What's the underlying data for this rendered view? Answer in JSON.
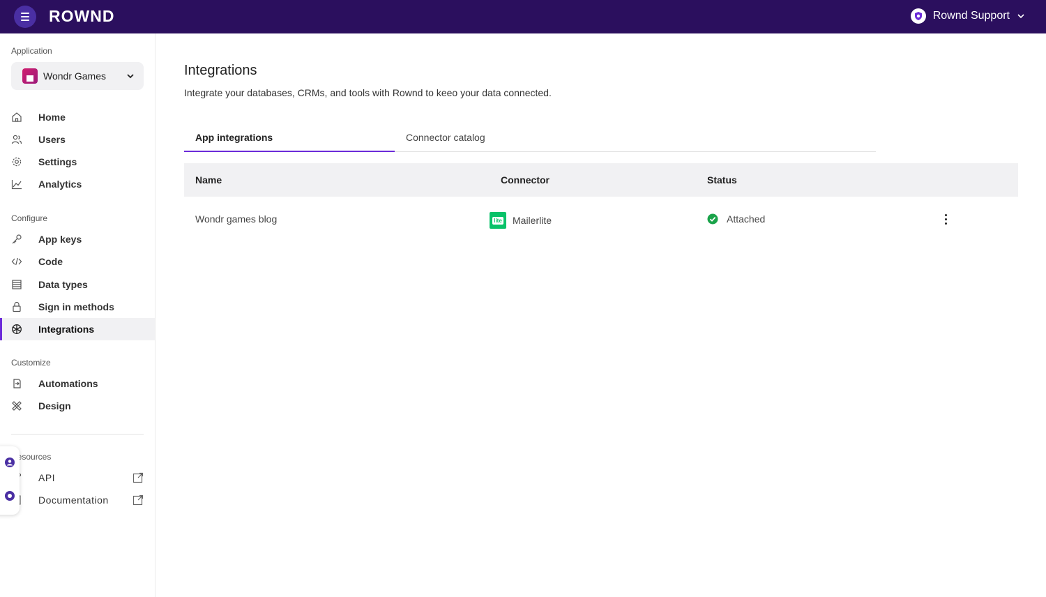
{
  "topbar": {
    "logo": "ROWND",
    "account_name": "Rownd Support"
  },
  "colors": {
    "topbar_bg": "#2b0f5e",
    "accent": "#6c2bd9",
    "status_green": "#1aa34a",
    "mailerlite_green": "#09c269"
  },
  "sidebar": {
    "application_label": "Application",
    "app_name": "Wondr Games",
    "main_items": [
      {
        "label": "Home",
        "icon": "home-icon"
      },
      {
        "label": "Users",
        "icon": "users-icon"
      },
      {
        "label": "Settings",
        "icon": "gear-icon"
      },
      {
        "label": "Analytics",
        "icon": "chart-icon"
      }
    ],
    "configure_label": "Configure",
    "configure_items": [
      {
        "label": "App keys",
        "icon": "key-icon"
      },
      {
        "label": "Code",
        "icon": "code-icon"
      },
      {
        "label": "Data types",
        "icon": "list-icon"
      },
      {
        "label": "Sign in methods",
        "icon": "lock-icon"
      },
      {
        "label": "Integrations",
        "icon": "integrations-icon"
      }
    ],
    "customize_label": "Customize",
    "customize_items": [
      {
        "label": "Automations",
        "icon": "automation-icon"
      },
      {
        "label": "Design",
        "icon": "design-icon"
      }
    ],
    "resources_label": "Resources",
    "resources_items": [
      {
        "label": "API",
        "icon": "api-icon"
      },
      {
        "label": "Documentation",
        "icon": "docs-icon"
      }
    ]
  },
  "main": {
    "title": "Integrations",
    "description": "Integrate your databases, CRMs, and tools with Rownd to keeo your data connected.",
    "tabs": [
      {
        "label": "App integrations"
      },
      {
        "label": "Connector catalog"
      }
    ],
    "table": {
      "columns": [
        "Name",
        "Connector",
        "Status"
      ],
      "rows": [
        {
          "name": "Wondr games blog",
          "connector": "Mailerlite",
          "connector_logo_text": "lite",
          "status": "Attached"
        }
      ]
    }
  }
}
